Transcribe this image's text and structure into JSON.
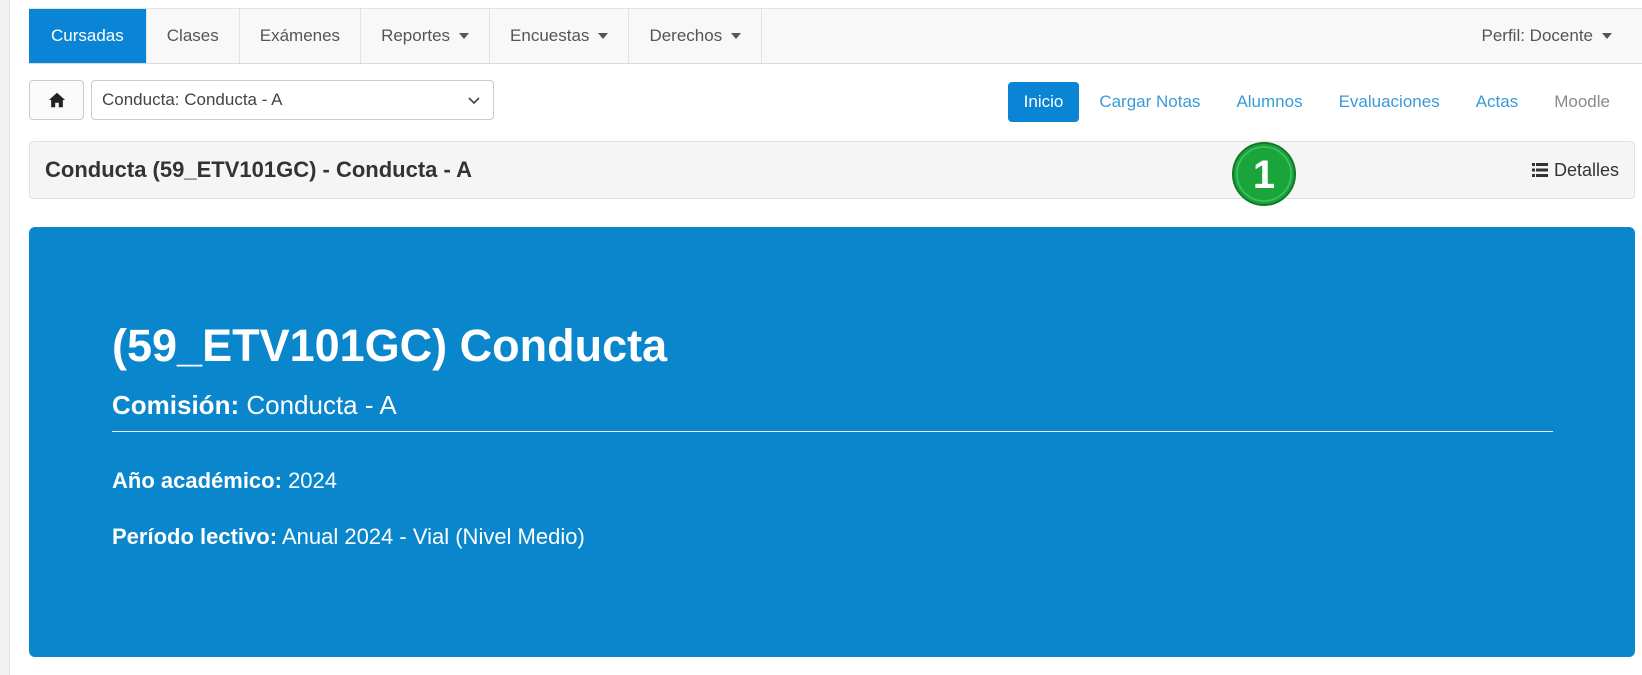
{
  "navbar": {
    "items": [
      {
        "label": "Cursadas",
        "active": true,
        "dropdown": false
      },
      {
        "label": "Clases",
        "active": false,
        "dropdown": false
      },
      {
        "label": "Exámenes",
        "active": false,
        "dropdown": false
      },
      {
        "label": "Reportes",
        "active": false,
        "dropdown": true
      },
      {
        "label": "Encuestas",
        "active": false,
        "dropdown": true
      },
      {
        "label": "Derechos",
        "active": false,
        "dropdown": true
      }
    ],
    "profile": "Perfil: Docente"
  },
  "toolbar": {
    "home_icon": "home-icon",
    "selected_course": "Conducta: Conducta - A"
  },
  "pills": [
    {
      "label": "Inicio",
      "active": true
    },
    {
      "label": "Cargar Notas",
      "active": false
    },
    {
      "label": "Alumnos",
      "active": false
    },
    {
      "label": "Evaluaciones",
      "active": false
    },
    {
      "label": "Actas",
      "active": false
    },
    {
      "label": "Moodle",
      "active": false
    }
  ],
  "title_bar": {
    "title": "Conducta (59_ETV101GC) - Conducta - A",
    "details_label": "Detalles"
  },
  "annotation": {
    "number": "1",
    "color": "#1aa53a"
  },
  "jumbotron": {
    "heading": "(59_ETV101GC) Conducta",
    "comision_label": "Comisión:",
    "comision_value": "Conducta - A",
    "anio_label": "Año académico:",
    "anio_value": "2024",
    "periodo_label": "Período lectivo:",
    "periodo_value": "Anual 2024 - Vial (Nivel Medio)"
  },
  "colors": {
    "primary": "#0a84d4",
    "jumbotron_bg": "#0a86cc",
    "link": "#3a9ad9"
  }
}
